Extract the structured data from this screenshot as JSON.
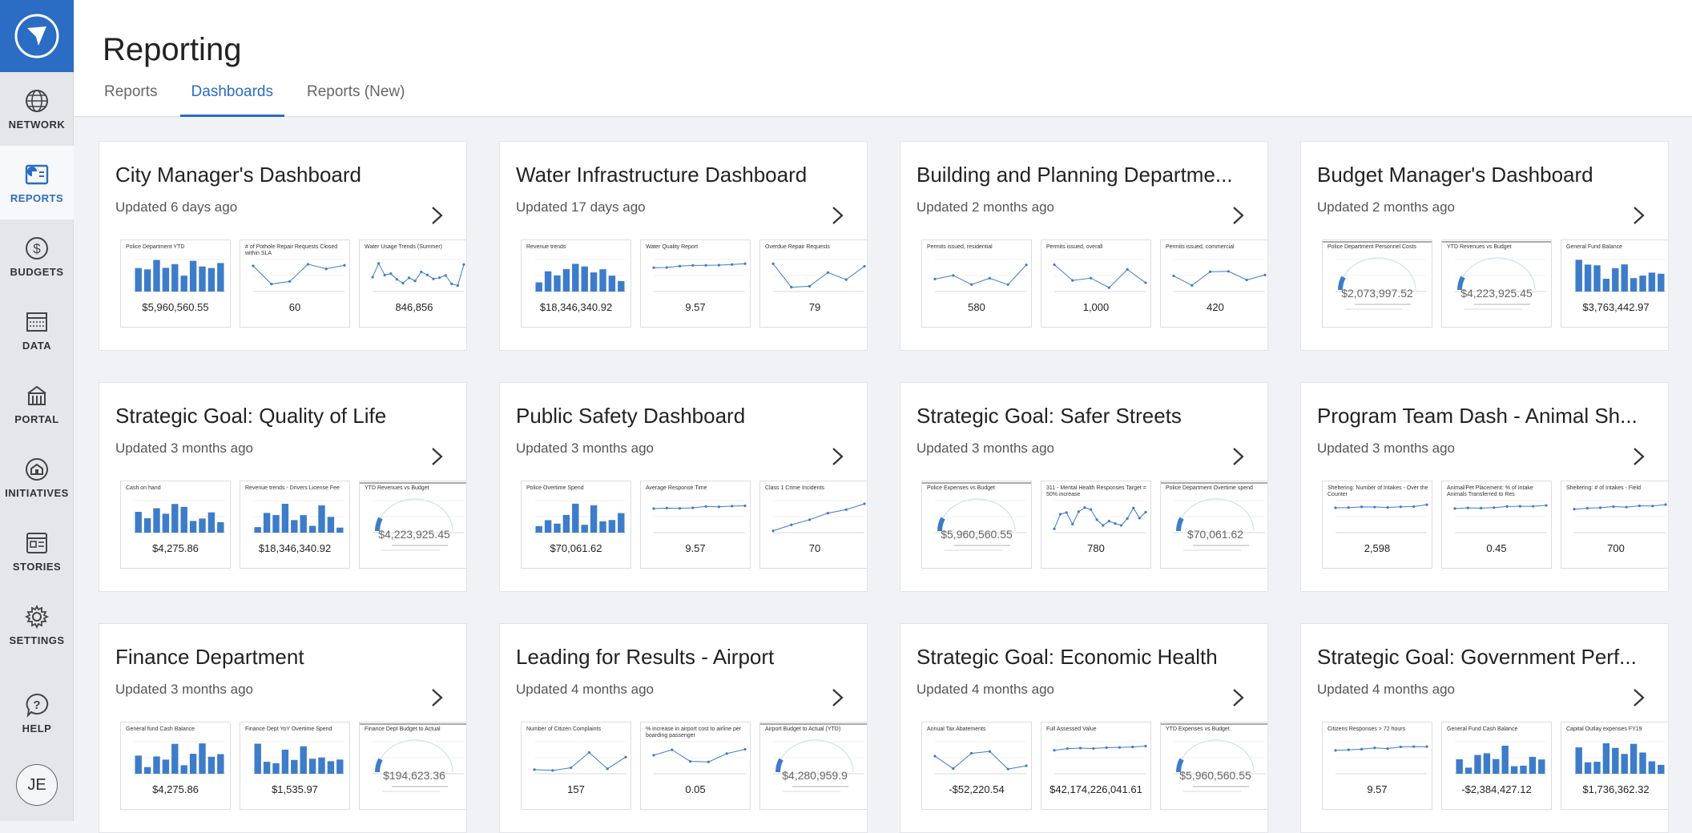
{
  "app": {
    "title": "Reporting",
    "tabs": [
      {
        "label": "Reports",
        "active": false
      },
      {
        "label": "Dashboards",
        "active": true
      },
      {
        "label": "Reports (New)",
        "active": false
      }
    ]
  },
  "sidebar": {
    "items": [
      {
        "label": "NETWORK",
        "icon": "globe-icon",
        "active": false
      },
      {
        "label": "REPORTS",
        "icon": "reports-icon",
        "active": true
      },
      {
        "label": "BUDGETS",
        "icon": "dollar-icon",
        "active": false
      },
      {
        "label": "DATA",
        "icon": "data-table-icon",
        "active": false
      },
      {
        "label": "PORTAL",
        "icon": "building-icon",
        "active": false
      },
      {
        "label": "INITIATIVES",
        "icon": "initiatives-icon",
        "active": false
      },
      {
        "label": "STORIES",
        "icon": "stories-icon",
        "active": false
      },
      {
        "label": "SETTINGS",
        "icon": "gear-icon",
        "active": false
      },
      {
        "label": "HELP",
        "icon": "help-icon",
        "active": false
      }
    ],
    "avatar_initials": "JE"
  },
  "colors": {
    "accent": "#2b6cc4",
    "chart": "#3d7cc9"
  },
  "dashboards": [
    {
      "title": "City Manager's Dashboard",
      "updated": "Updated 6 days ago",
      "tiles": [
        {
          "title": "Police Department YTD",
          "value": "$5,960,560.55",
          "kind": "bar"
        },
        {
          "title": "# of Pothole Repair Requests Closed within SLA",
          "value": "60",
          "kind": "line"
        },
        {
          "title": "Water Usage Trends (Summer)",
          "value": "846,856",
          "kind": "spark"
        }
      ]
    },
    {
      "title": "Water Infrastructure Dashboard",
      "updated": "Updated 17 days ago",
      "tiles": [
        {
          "title": "Revenue trends",
          "value": "$18,346,340.92",
          "kind": "bar"
        },
        {
          "title": "Water Quality Report",
          "value": "9.57",
          "kind": "flat"
        },
        {
          "title": "Overdue Repair Requests",
          "value": "79",
          "kind": "line"
        }
      ]
    },
    {
      "title": "Building and Planning Departme...",
      "updated": "Updated 2 months ago",
      "tiles": [
        {
          "title": "Permits issued, residential",
          "value": "580",
          "kind": "line"
        },
        {
          "title": "Permits issued, overall",
          "value": "1,000",
          "kind": "line"
        },
        {
          "title": "Permits issued, commercial",
          "value": "420",
          "kind": "line"
        }
      ]
    },
    {
      "title": "Budget Manager's Dashboard",
      "updated": "Updated 2 months ago",
      "tiles": [
        {
          "title": "Police Department Personnel Costs",
          "value": "$2,073,997.52",
          "kind": "gauge"
        },
        {
          "title": "YTD Revenues vs Budget",
          "value": "$4,223,925.45",
          "kind": "gauge"
        },
        {
          "title": "General Fund Balance",
          "value": "$3,763,442.97",
          "kind": "bar"
        }
      ]
    },
    {
      "title": "Strategic Goal: Quality of Life",
      "updated": "Updated 3 months ago",
      "tiles": [
        {
          "title": "Cash on hand",
          "value": "$4,275.86",
          "kind": "bar"
        },
        {
          "title": "Revenue trends - Drivers License Fee",
          "value": "$18,346,340.92",
          "kind": "bar"
        },
        {
          "title": "YTD Revenues vs Budget",
          "value": "$4,223,925.45",
          "kind": "gauge"
        }
      ]
    },
    {
      "title": "Public Safety Dashboard",
      "updated": "Updated 3 months ago",
      "tiles": [
        {
          "title": "Police Overtime Spend",
          "value": "$70,061.62",
          "kind": "bar"
        },
        {
          "title": "Average Response Time",
          "value": "9.57",
          "kind": "flat"
        },
        {
          "title": "Class 1 Crime Incidents",
          "value": "70",
          "kind": "rise"
        }
      ]
    },
    {
      "title": "Strategic Goal: Safer Streets",
      "updated": "Updated 3 months ago",
      "tiles": [
        {
          "title": "Police Expenses vs Budget",
          "value": "$5,960,560.55",
          "kind": "gauge"
        },
        {
          "title": "311 - Mental Health Responses Target = 50% increase",
          "value": "780",
          "kind": "spark"
        },
        {
          "title": "Police Department Overtime spend",
          "value": "$70,061.62",
          "kind": "gauge"
        }
      ]
    },
    {
      "title": "Program Team Dash - Animal Sh...",
      "updated": "Updated 3 months ago",
      "tiles": [
        {
          "title": "Sheltering: Number of Intakes - Over the Counter",
          "value": "2,598",
          "kind": "flat"
        },
        {
          "title": "Animal/Pet Placement: % of Intake Animals Transferred to Res",
          "value": "0.45",
          "kind": "flat"
        },
        {
          "title": "Sheltering: # of Intakes - Field",
          "value": "700",
          "kind": "flat"
        }
      ]
    },
    {
      "title": "Finance Department",
      "updated": "Updated 3 months ago",
      "tiles": [
        {
          "title": "General fund Cash Balance",
          "value": "$4,275.86",
          "kind": "bar"
        },
        {
          "title": "Finance Dept YoY Overtime Spend",
          "value": "$1,535.97",
          "kind": "bar"
        },
        {
          "title": "Finance Dept Budget to Actual",
          "value": "$194,623.36",
          "kind": "gauge"
        }
      ]
    },
    {
      "title": "Leading for Results - Airport",
      "updated": "Updated 4 months ago",
      "tiles": [
        {
          "title": "Number of Citizen Complaints",
          "value": "157",
          "kind": "line"
        },
        {
          "title": "% increase in airport cost to airline per boarding passenger",
          "value": "0.05",
          "kind": "line"
        },
        {
          "title": "Airport Budget to Actual (YTD)",
          "value": "$4,280,959.9",
          "kind": "gauge"
        }
      ]
    },
    {
      "title": "Strategic Goal: Economic Health",
      "updated": "Updated 4 months ago",
      "tiles": [
        {
          "title": "Annual Tax Abatements",
          "value": "-$52,220.54",
          "kind": "line"
        },
        {
          "title": "Full Assessed Value",
          "value": "$42,174,226,041.61",
          "kind": "flat"
        },
        {
          "title": "YTD Expenses vs Budget",
          "value": "$5,960,560.55",
          "kind": "gauge"
        }
      ]
    },
    {
      "title": "Strategic Goal: Government Perf...",
      "updated": "Updated 4 months ago",
      "tiles": [
        {
          "title": "Citizens Responses > 72 hours",
          "value": "9.57",
          "kind": "flat"
        },
        {
          "title": "General Fund Cash Balance",
          "value": "-$2,384,427.12",
          "kind": "bar"
        },
        {
          "title": "Capital Outlay expenses FY19",
          "value": "$1,736,362.32",
          "kind": "bar"
        }
      ]
    }
  ]
}
